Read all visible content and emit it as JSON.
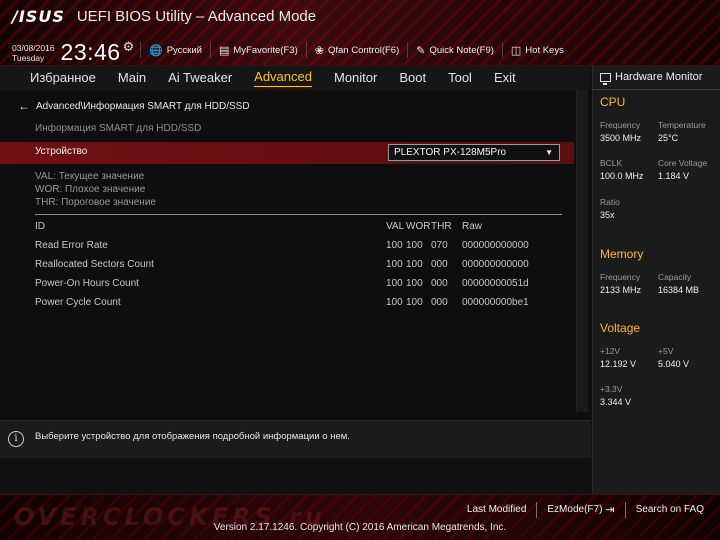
{
  "header": {
    "logo": "/ISUS",
    "title": "UEFI BIOS Utility – Advanced Mode",
    "date": "03/08/2016",
    "weekday": "Tuesday",
    "time": "23:46",
    "utilities": [
      {
        "icon": "globe-icon",
        "label": "Русский"
      },
      {
        "icon": "favorite-icon",
        "label": "MyFavorite(F3)"
      },
      {
        "icon": "fan-icon",
        "label": "Qfan Control(F6)"
      },
      {
        "icon": "note-icon",
        "label": "Quick Note(F9)"
      },
      {
        "icon": "help-icon",
        "label": "Hot Keys"
      }
    ]
  },
  "tabs": [
    {
      "label": "Избранное",
      "active": false
    },
    {
      "label": "Main",
      "active": false
    },
    {
      "label": "Ai Tweaker",
      "active": false
    },
    {
      "label": "Advanced",
      "active": true
    },
    {
      "label": "Monitor",
      "active": false
    },
    {
      "label": "Boot",
      "active": false
    },
    {
      "label": "Tool",
      "active": false
    },
    {
      "label": "Exit",
      "active": false
    }
  ],
  "main": {
    "breadcrumb": "Advanced\\Информация SMART для HDD/SSD",
    "subheading": "Информация SMART для HDD/SSD",
    "device_label": "Устройство",
    "device_value": "PLEXTOR PX-128M5Pro",
    "legend": [
      "VAL: Текущее значение",
      "WOR: Плохое значение",
      "THR: Пороговое значение"
    ],
    "table": {
      "headers": {
        "id": "ID",
        "val": "VAL",
        "wor": "WOR",
        "thr": "THR",
        "raw": "Raw"
      },
      "rows": [
        {
          "id": "Read Error Rate",
          "val": "100",
          "wor": "100",
          "thr": "070",
          "raw": "000000000000"
        },
        {
          "id": "Reallocated Sectors Count",
          "val": "100",
          "wor": "100",
          "thr": "000",
          "raw": "000000000000"
        },
        {
          "id": "Power-On Hours Count",
          "val": "100",
          "wor": "100",
          "thr": "000",
          "raw": "00000000051d"
        },
        {
          "id": "Power Cycle Count",
          "val": "100",
          "wor": "100",
          "thr": "000",
          "raw": "000000000be1"
        }
      ]
    }
  },
  "info": {
    "text": "Выберите устройство для отображения подробной информации о нем."
  },
  "hardware_monitor": {
    "title": "Hardware Monitor",
    "cpu": {
      "heading": "CPU",
      "frequency_label": "Frequency",
      "frequency": "3500 MHz",
      "temperature_label": "Temperature",
      "temperature": "25°C",
      "bclk_label": "BCLK",
      "bclk": "100.0 MHz",
      "core_voltage_label": "Core Voltage",
      "core_voltage": "1.184 V",
      "ratio_label": "Ratio",
      "ratio": "35x"
    },
    "memory": {
      "heading": "Memory",
      "frequency_label": "Frequency",
      "frequency": "2133 MHz",
      "capacity_label": "Capacity",
      "capacity": "16384 MB"
    },
    "voltage": {
      "heading": "Voltage",
      "v12_label": "+12V",
      "v12": "12.192 V",
      "v5_label": "+5V",
      "v5": "5.040 V",
      "v33_label": "+3.3V",
      "v33": "3.344 V"
    }
  },
  "footer": {
    "last_modified": "Last Modified",
    "ezmode": "EzMode(F7)",
    "search_faq": "Search on FAQ",
    "version": "Version 2.17.1246. Copyright (C) 2016 American Megatrends, Inc.",
    "watermark": "OVERCLOCKERS.ru"
  },
  "colors": {
    "accent": "#ffc226",
    "section_heading": "#ffb72a",
    "selected_row": "#6e1014"
  }
}
